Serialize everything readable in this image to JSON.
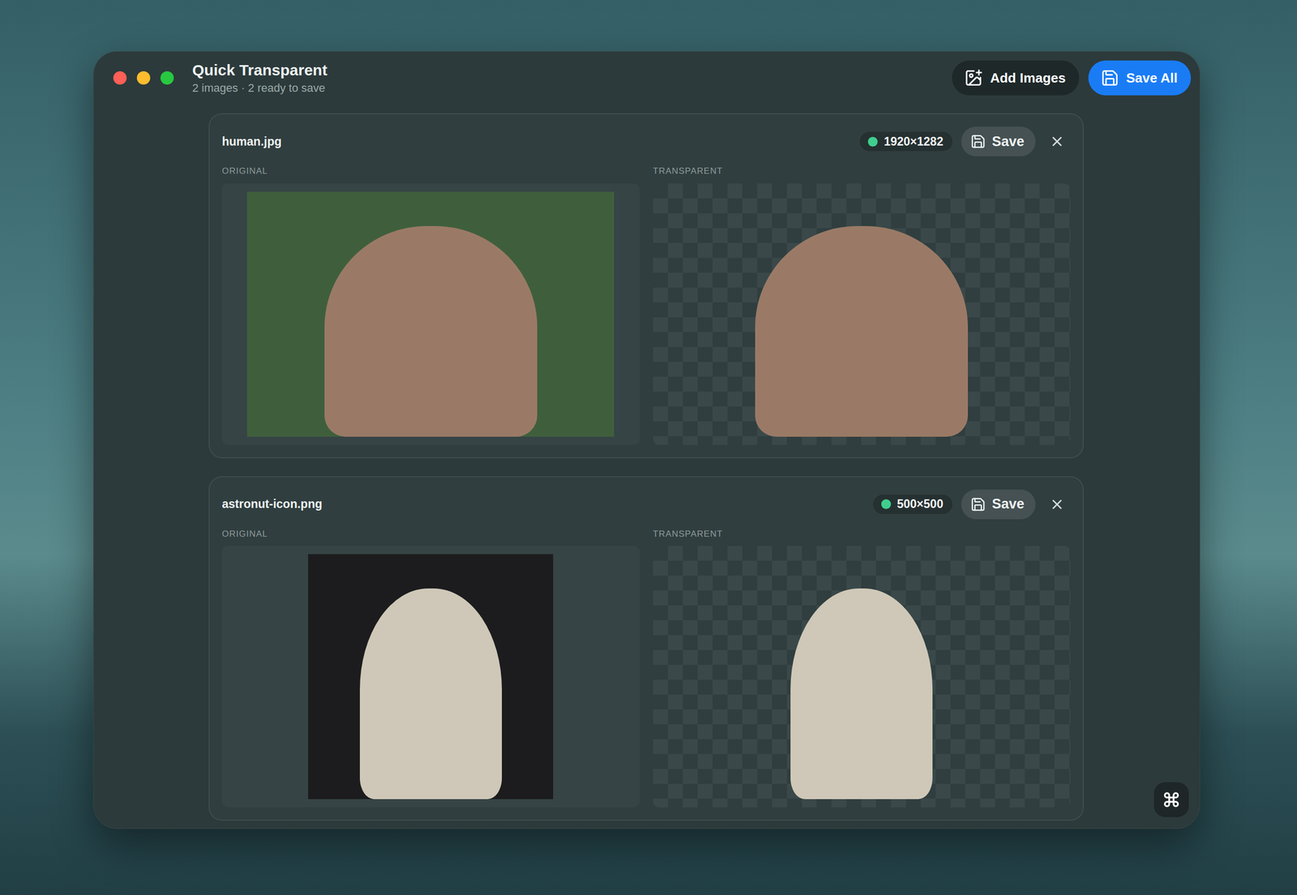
{
  "window": {
    "title": "Quick Transparent",
    "subtitle": "2 images · 2 ready to save"
  },
  "toolbar": {
    "buttons": [
      {
        "label": "Add Images",
        "kind": "secondary"
      },
      {
        "label": "Save All",
        "kind": "primary"
      }
    ]
  },
  "images": [
    {
      "name": "human.jpg",
      "dimensions": "1920×1282",
      "status_color": "#3ecf8e",
      "save_label": "Save",
      "original_label": "ORIGINAL",
      "transparent_label": "TRANSPARENT",
      "preview_color": "#3f5f3c",
      "subject_color": "#9a7a66"
    },
    {
      "name": "astronut-icon.png",
      "dimensions": "500×500",
      "status_color": "#3ecf8e",
      "save_label": "Save",
      "original_label": "ORIGINAL",
      "transparent_label": "TRANSPARENT",
      "preview_color": "#1c1c1e",
      "subject_color": "#cfc8b8"
    }
  ]
}
